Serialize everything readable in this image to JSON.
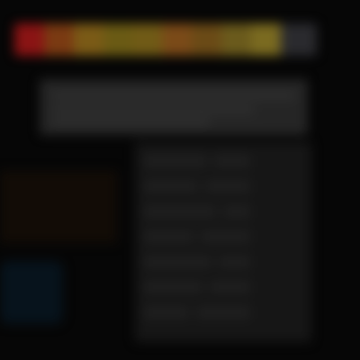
{
  "color_strip": {
    "swatches": [
      {
        "color": "#8a1414"
      },
      {
        "color": "#7a3a12"
      },
      {
        "color": "#7a5a16"
      },
      {
        "color": "#6a5a14"
      },
      {
        "color": "#705a16"
      },
      {
        "color": "#7a4a18"
      },
      {
        "color": "#6a4a16"
      },
      {
        "color": "#6a5a1c"
      },
      {
        "color": "#7a6a20"
      }
    ],
    "end_color": "#2a2a2e"
  },
  "accents": {
    "panel_bg": "#161616",
    "banner_bg": "#252525",
    "warm_glow": "#120c06",
    "cool_glow": "#07131c"
  }
}
